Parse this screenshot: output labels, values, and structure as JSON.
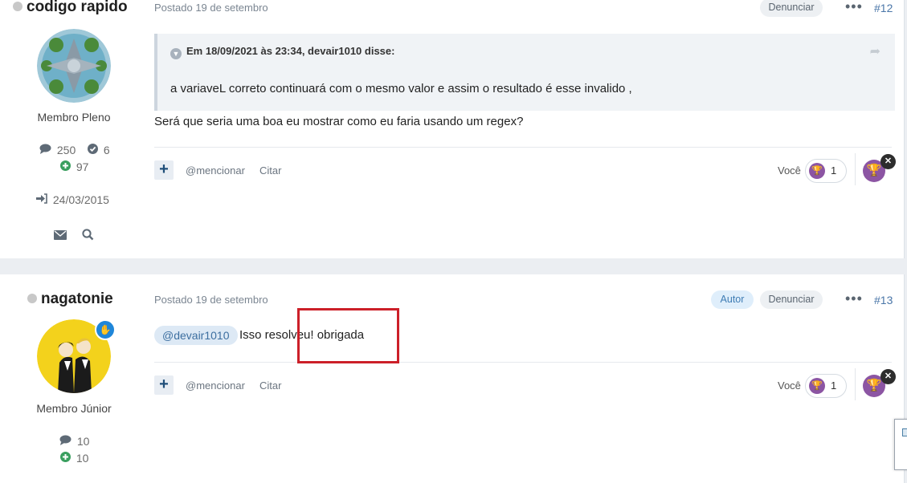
{
  "post1": {
    "author": "codigo rapido",
    "rank": "Membro Pleno",
    "stats": {
      "messages": "250",
      "solutions": "6",
      "reputation": "97"
    },
    "joined": "24/03/2015",
    "posted": "Postado 19 de setembro",
    "report_label": "Denunciar",
    "number": "#12",
    "quote": {
      "header": "Em 18/09/2021 às 23:34, devair1010 disse:",
      "body": "a variaveL correto continuará com o mesmo valor e assim o resultado é esse invalido ,"
    },
    "body": "Será que seria uma boa eu mostrar como eu faria usando um regex?",
    "actions": {
      "mention": "@mencionar",
      "quote": "Citar"
    },
    "reactions": {
      "you_label": "Você",
      "count": "1"
    }
  },
  "post2": {
    "author": "nagatonie",
    "rank": "Membro Júnior",
    "stats": {
      "messages": "10",
      "reputation": "10"
    },
    "posted": "Postado 19 de setembro",
    "author_badge": "Autor",
    "report_label": "Denunciar",
    "number": "#13",
    "mention": "@devair1010",
    "body": "Isso resolveu! obrigada",
    "actions": {
      "mention": "@mencionar",
      "quote": "Citar"
    },
    "reactions": {
      "you_label": "Você",
      "count": "1"
    }
  },
  "icons": {
    "status": "offline-dot-icon",
    "messages": "comment-icon",
    "solutions": "check-circle-icon",
    "reputation": "plus-circle-icon",
    "joined": "sign-in-icon",
    "message": "envelope-icon",
    "search": "search-icon",
    "reaction": "trophy-icon",
    "close": "close-icon",
    "more": "ellipsis-icon",
    "quote_toggle": "chevron-down-icon",
    "share": "share-icon",
    "moderator": "hand-icon"
  },
  "colors": {
    "accent": "#4a76a8",
    "reaction": "#8c55a3",
    "reputation_plus": "#3a9f5f",
    "highlight_box": "#cc2029"
  }
}
